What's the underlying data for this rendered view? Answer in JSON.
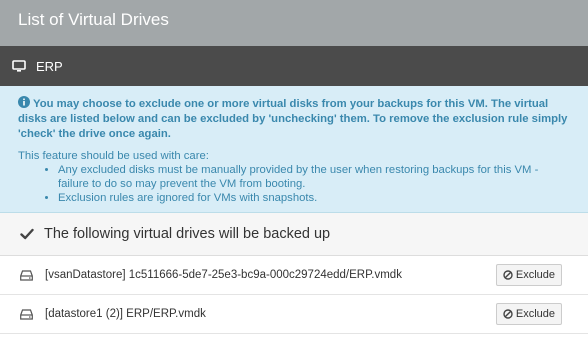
{
  "window": {
    "title": "List of Virtual Drives"
  },
  "vm": {
    "icon": "monitor-icon",
    "name": "ERP"
  },
  "info": {
    "icon": "info-icon",
    "intro": "You may choose to exclude one or more virtual disks from your backups for this VM. The virtual disks are listed below and can be excluded by 'unchecking' them. To remove the exclusion rule simply 'check' the drive once again.",
    "care_heading": "This feature should be used with care:",
    "bullets": [
      "Any excluded disks must be manually provided by the user when restoring backups for this VM - failure to do so may prevent the VM from booting.",
      "Exclusion rules are ignored for VMs with snapshots."
    ]
  },
  "section": {
    "icon": "check-icon",
    "title": "The following virtual drives will be backed up"
  },
  "drives": [
    {
      "icon": "hard-drive-icon",
      "path": "[vsanDatastore] 1c511666-5de7-25e3-bc9a-000c29724edd/ERP.vmdk",
      "button_label": "Exclude",
      "button_icon": "ban-icon"
    },
    {
      "icon": "hard-drive-icon",
      "path": "[datastore1 (2)] ERP/ERP.vmdk",
      "button_label": "Exclude",
      "button_icon": "ban-icon"
    }
  ]
}
